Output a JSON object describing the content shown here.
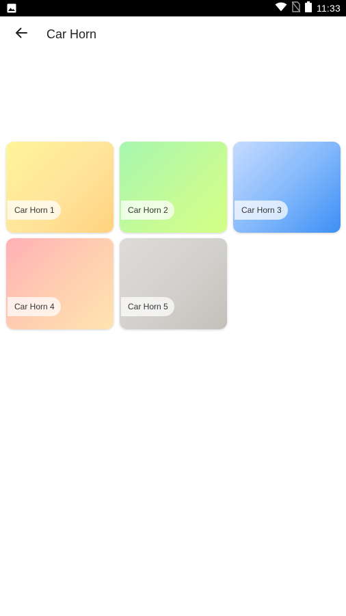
{
  "status_bar": {
    "time": "11:33",
    "icons": [
      "gallery-notification-icon",
      "wifi-icon",
      "no-sim-icon",
      "battery-icon"
    ]
  },
  "header": {
    "title": "Car Horn",
    "back_icon": "arrow-back-icon"
  },
  "hero": {
    "icon": "waveform-icon"
  },
  "sounds": [
    {
      "label": "Car Horn 1",
      "gradient": [
        "#fff59a",
        "#ffd27e"
      ]
    },
    {
      "label": "Car Horn 2",
      "gradient": [
        "#a6f7b0",
        "#d3ff85"
      ]
    },
    {
      "label": "Car Horn 3",
      "gradient": [
        "#c6dbff",
        "#3d8ff5"
      ]
    },
    {
      "label": "Car Horn 4",
      "gradient": [
        "#ffb0b6",
        "#ffe3b1"
      ]
    },
    {
      "label": "Car Horn 5",
      "gradient": [
        "#dedcd9",
        "#c3c0ba"
      ]
    }
  ],
  "colors": {
    "waveform_start": "#cc44ee",
    "waveform_mid": "#44aaff",
    "waveform_end": "#5577ee",
    "title_text": "#212121",
    "status_bar": "#000000"
  }
}
